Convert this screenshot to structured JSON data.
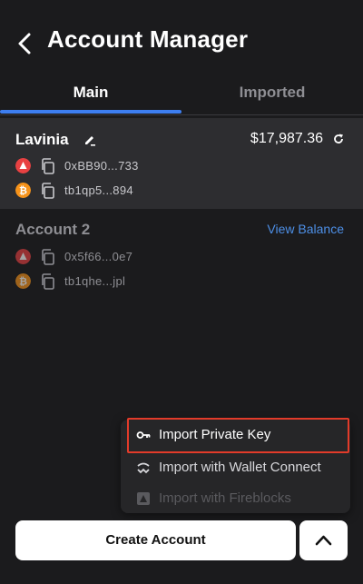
{
  "header": {
    "title": "Account Manager"
  },
  "tabs": [
    {
      "label": "Main",
      "active": true
    },
    {
      "label": "Imported",
      "active": false
    }
  ],
  "accounts": [
    {
      "name": "Lavinia",
      "balance": "$17,987.36",
      "addresses": [
        {
          "coin": "avalanche-icon",
          "value": "0xBB90...733"
        },
        {
          "coin": "bitcoin-icon",
          "value": "tb1qp5...894"
        }
      ]
    },
    {
      "name": "Account 2",
      "view_balance_label": "View Balance",
      "addresses": [
        {
          "coin": "avalanche-icon",
          "value": "0x5f66...0e7"
        },
        {
          "coin": "bitcoin-icon",
          "value": "tb1qhe...jpl"
        }
      ]
    }
  ],
  "import_menu": {
    "items": [
      {
        "label": "Import Private Key",
        "icon": "key-icon"
      },
      {
        "label": "Import with Wallet Connect",
        "icon": "wallet-connect-icon"
      },
      {
        "label": "Import with Fireblocks",
        "icon": "fireblocks-icon",
        "disabled": true
      }
    ]
  },
  "footer": {
    "create_label": "Create Account"
  },
  "colors": {
    "accent": "#3d7ef0",
    "link": "#4d8fe6",
    "avalanche": "#e84142",
    "bitcoin": "#f7931a",
    "highlight": "#e23b2a"
  }
}
